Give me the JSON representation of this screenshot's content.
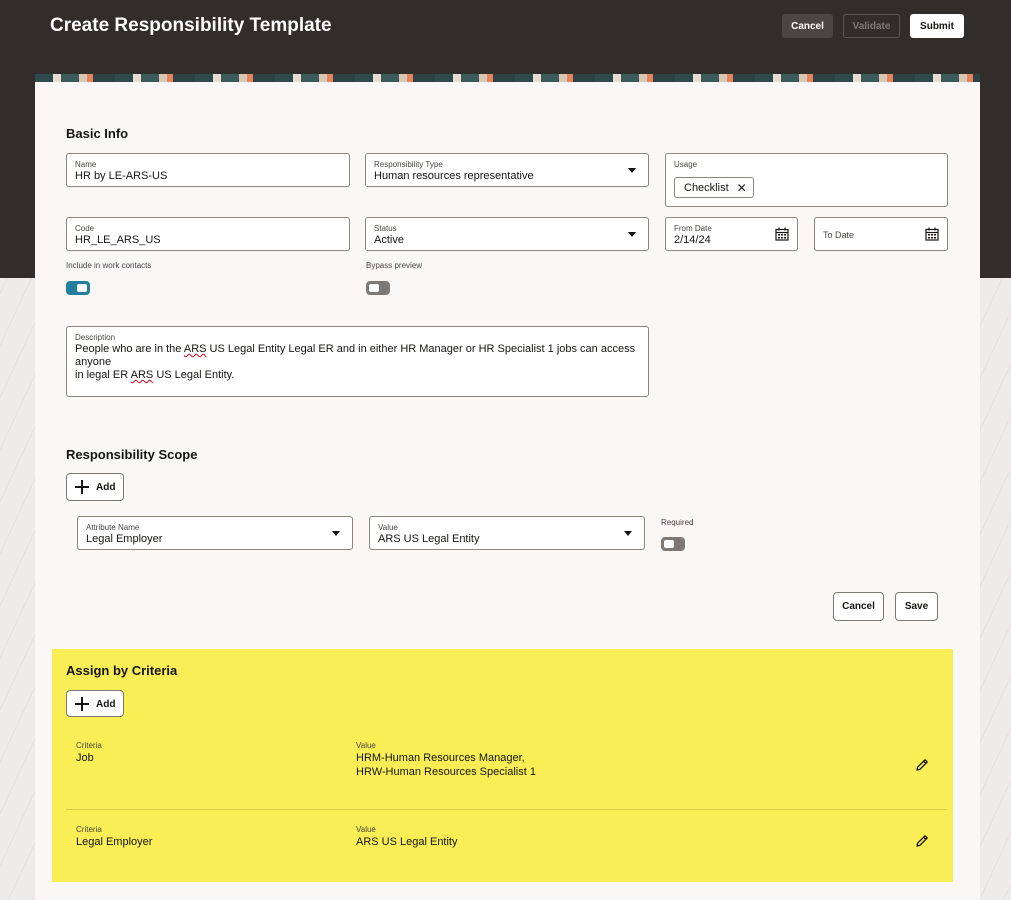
{
  "header": {
    "title": "Create Responsibility Template",
    "cancel_label": "Cancel",
    "validate_label": "Validate",
    "submit_label": "Submit"
  },
  "basic_info": {
    "title": "Basic Info",
    "name": {
      "label": "Name",
      "value": "HR by LE-ARS-US"
    },
    "responsibility_type": {
      "label": "Responsibility Type",
      "value": "Human resources representative"
    },
    "usage": {
      "label": "Usage",
      "chip": "Checklist"
    },
    "code": {
      "label": "Code",
      "value": "HR_LE_ARS_US"
    },
    "status": {
      "label": "Status",
      "value": "Active"
    },
    "from_date": {
      "label": "From Date",
      "value": "2/14/24"
    },
    "to_date": {
      "label": "To Date"
    },
    "include_work_contacts": {
      "label": "Include in work contacts",
      "on": true
    },
    "bypass_preview": {
      "label": "Bypass preview",
      "on": false
    },
    "description": {
      "label": "Description",
      "line1_a": "People who are in the ",
      "line1_b": "ARS",
      "line1_c": " US Legal Entity Legal ER and in either HR Manager or HR Specialist 1 jobs can access anyone",
      "line2_a": "in legal ER ",
      "line2_b": "ARS",
      "line2_c": " US Legal Entity."
    }
  },
  "scope": {
    "title": "Responsibility Scope",
    "add_label": "Add",
    "attribute_name": {
      "label": "Attribute Name",
      "value": "Legal Employer"
    },
    "value": {
      "label": "Value",
      "value": "ARS US Legal Entity"
    },
    "required": {
      "label": "Required",
      "on": false
    },
    "cancel_label": "Cancel",
    "save_label": "Save"
  },
  "criteria": {
    "title": "Assign by Criteria",
    "add_label": "Add",
    "rows": [
      {
        "criteria_label": "Criteria",
        "criteria": "Job",
        "value_label": "Value",
        "value_line1": "HRM-Human Resources Manager,",
        "value_line2": "HRW-Human Resources Specialist 1"
      },
      {
        "criteria_label": "Criteria",
        "criteria": "Legal Employer",
        "value_label": "Value",
        "value_line1": "ARS US Legal Entity",
        "value_line2": ""
      }
    ]
  },
  "colors": {
    "header_bg": "#312d2a",
    "criteria_highlight": "#f9ee55",
    "toggle_on": "#227e9e"
  },
  "icons": [
    "caret-down-icon",
    "calendar-icon",
    "close-icon",
    "plus-icon",
    "pencil-icon"
  ]
}
